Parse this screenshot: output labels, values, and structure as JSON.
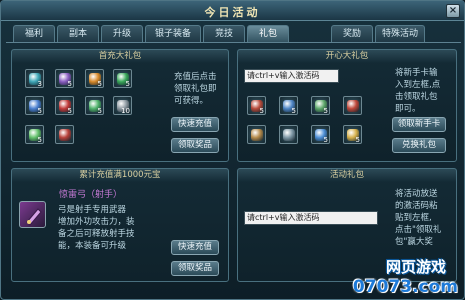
{
  "window": {
    "title": "今日活动",
    "close_glyph": "×"
  },
  "tabs": [
    {
      "label": "福利"
    },
    {
      "label": "副本"
    },
    {
      "label": "升级"
    },
    {
      "label": "银子装备"
    },
    {
      "label": "竞技"
    },
    {
      "label": "礼包",
      "active": true
    },
    {
      "label": "奖励"
    },
    {
      "label": "特殊活动"
    }
  ],
  "first_charge": {
    "header": "首充大礼包",
    "description": [
      "充值后点击",
      "领取礼包即",
      "可获得。"
    ],
    "items": [
      {
        "icon": "teal-orb-icon",
        "count": "3",
        "color": "#3fa8b8"
      },
      {
        "icon": "purple-orb-icon",
        "count": "5",
        "color": "#8a5ec2"
      },
      {
        "icon": "orange-gem-icon",
        "count": "5",
        "color": "#d98a2a"
      },
      {
        "icon": "green-gem-icon",
        "count": "5",
        "color": "#3aa85a"
      },
      {
        "icon": "blue-crystal-icon",
        "count": "5",
        "color": "#4a7fd0"
      },
      {
        "icon": "red-gem-icon",
        "count": "5",
        "color": "#c23a3a"
      },
      {
        "icon": "green-scroll-icon",
        "count": "5",
        "color": "#4fb26a"
      },
      {
        "icon": "shield-icon",
        "count": "10",
        "color": "#8f9aa2"
      },
      {
        "icon": "green-blade-icon",
        "count": "5",
        "color": "#62c06a"
      },
      {
        "icon": "red-box-icon",
        "count": "",
        "color": "#b8413a"
      }
    ],
    "btn_recharge": "快速充值",
    "btn_claim": "领取奖品"
  },
  "happy": {
    "header": "开心大礼包",
    "input_value": "请ctrl+v输入激活码",
    "description": [
      "将新手卡输",
      "入到左框,点",
      "击领取礼包",
      "即可。"
    ],
    "items": [
      {
        "icon": "red-tome-icon",
        "count": "5",
        "color": "#b84a3a"
      },
      {
        "icon": "blue-orb-icon",
        "count": "5",
        "color": "#4f86c6"
      },
      {
        "icon": "green-scroll-icon",
        "count": "5",
        "color": "#5da86a"
      },
      {
        "icon": "red-box-icon",
        "count": "",
        "color": "#c0483a"
      },
      {
        "icon": "bronze-ring-icon",
        "count": "",
        "color": "#b58a4a"
      },
      {
        "icon": "shield-icon",
        "count": "",
        "color": "#7f98a6"
      },
      {
        "icon": "blue-dagger-icon",
        "count": "5",
        "color": "#4d8fd6"
      },
      {
        "icon": "gold-coin-icon",
        "count": "5",
        "color": "#d6b04a"
      }
    ],
    "btn_claim_newbie": "领取新手卡",
    "btn_redeem": "兑换礼包"
  },
  "cumulative": {
    "header": "累计充值满1000元宝",
    "item_name": "惊雷弓（射手）",
    "description": [
      "弓是射手专用武器",
      "增加外功攻击力，装",
      "备之后可释放射手技",
      "能，本装备可升级"
    ],
    "btn_recharge": "快速充值",
    "btn_claim": "领取奖品"
  },
  "event": {
    "header": "活动礼包",
    "input_value": "请ctrl+v输入激活码",
    "description": [
      "将活动放送",
      "的激活码粘",
      "贴到左框,",
      "点击\"领取礼",
      "包\"赢大奖"
    ]
  },
  "watermark": {
    "line1": "网页游戏",
    "line2": "07073.com"
  }
}
